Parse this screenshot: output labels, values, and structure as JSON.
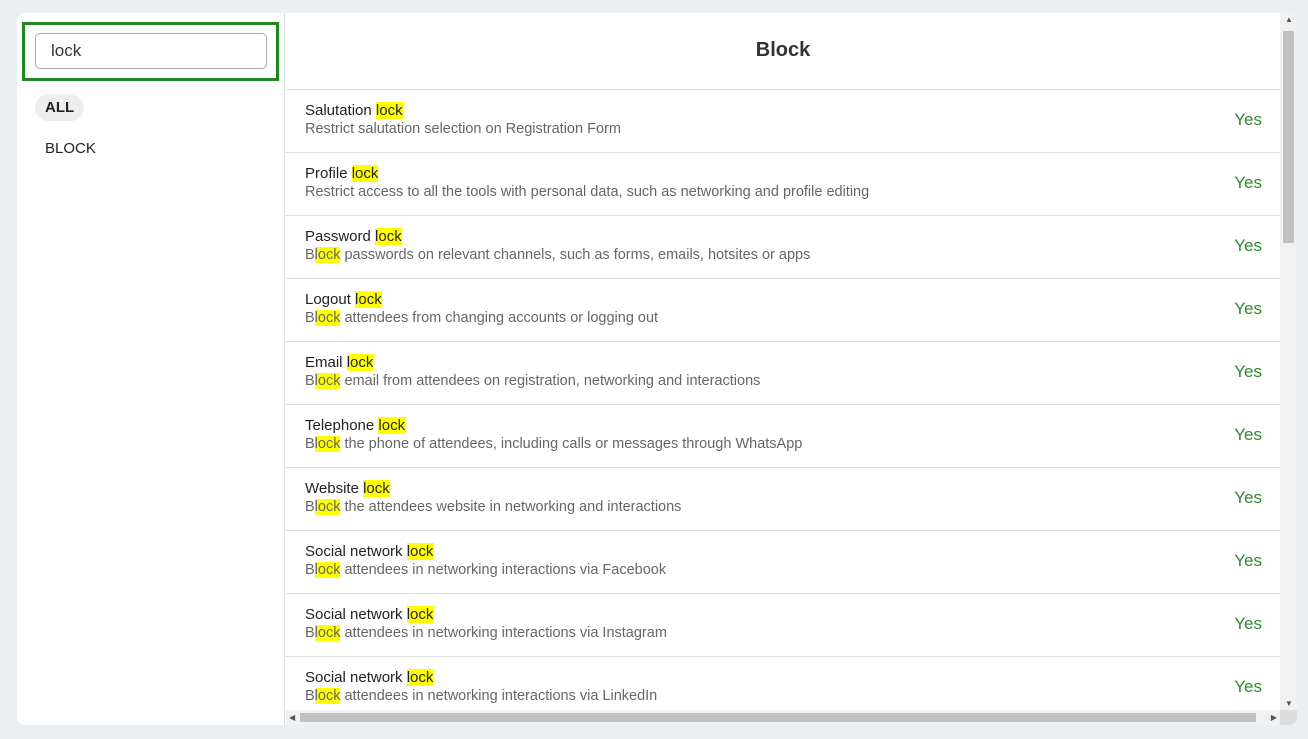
{
  "search": {
    "value": "lock"
  },
  "categories": [
    "ALL",
    "BLOCK"
  ],
  "main": {
    "title": "Block"
  },
  "colors": {
    "accent": "#1e8a1e",
    "highlight": "#ffff00",
    "yes": "#2e8b2e"
  },
  "rows": [
    {
      "title_prefix": "Salutation ",
      "title_match": "lock",
      "desc_prefix": "Restrict salutation selection on Registration Form",
      "desc_match": "",
      "desc_rest": "",
      "value": "Yes"
    },
    {
      "title_prefix": "Profile ",
      "title_match": "lock",
      "desc_prefix": "Restrict access to all the tools with personal data, such as networking and profile editing",
      "desc_match": "",
      "desc_rest": "",
      "value": "Yes"
    },
    {
      "title_prefix": "Password ",
      "title_match": "lock",
      "desc_prefix": "B",
      "desc_match": "lock",
      "desc_rest": " passwords on relevant channels, such as forms, emails, hotsites or apps",
      "value": "Yes"
    },
    {
      "title_prefix": "Logout ",
      "title_match": "lock",
      "desc_prefix": "B",
      "desc_match": "lock",
      "desc_rest": " attendees from changing accounts or logging out",
      "value": "Yes"
    },
    {
      "title_prefix": "Email ",
      "title_match": "lock",
      "desc_prefix": "B",
      "desc_match": "lock",
      "desc_rest": " email from attendees on registration, networking and interactions",
      "value": "Yes"
    },
    {
      "title_prefix": "Telephone ",
      "title_match": "lock",
      "desc_prefix": "B",
      "desc_match": "lock",
      "desc_rest": " the phone of attendees, including calls or messages through WhatsApp",
      "value": "Yes"
    },
    {
      "title_prefix": "Website ",
      "title_match": "lock",
      "desc_prefix": "B",
      "desc_match": "lock",
      "desc_rest": " the attendees website in networking and interactions",
      "value": "Yes"
    },
    {
      "title_prefix": "Social network ",
      "title_match": "lock",
      "desc_prefix": "B",
      "desc_match": "lock",
      "desc_rest": " attendees in networking interactions via Facebook",
      "value": "Yes"
    },
    {
      "title_prefix": "Social network ",
      "title_match": "lock",
      "desc_prefix": "B",
      "desc_match": "lock",
      "desc_rest": " attendees in networking interactions via Instagram",
      "value": "Yes"
    },
    {
      "title_prefix": "Social network ",
      "title_match": "lock",
      "desc_prefix": "B",
      "desc_match": "lock",
      "desc_rest": " attendees in networking interactions via LinkedIn",
      "value": "Yes"
    }
  ]
}
